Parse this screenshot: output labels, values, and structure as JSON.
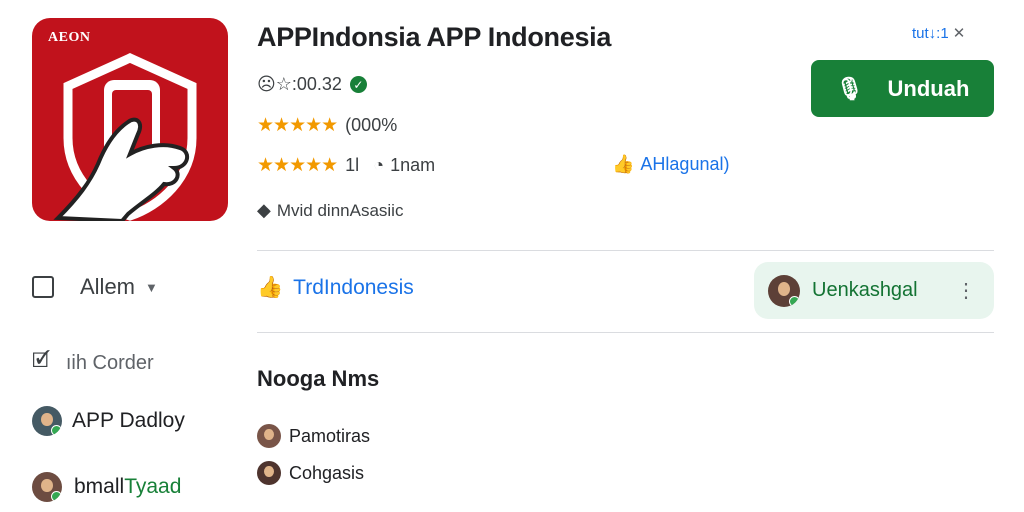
{
  "app": {
    "icon_label": "AEON",
    "title": "APPIndonsia APP Indonesia",
    "rating_line": "☹☆:00.32",
    "stars_1": "★★★★★",
    "rating_count": "(000%",
    "stars_2": "★★★★★",
    "stars_2_value": "1Ɩ",
    "install_icon_text": "◔",
    "installs": "1nam",
    "extra_link": "AHlagunal)",
    "maker": "Mvid dinnAsasiic"
  },
  "window_controls": {
    "label": "tut↓:1",
    "close": "✕"
  },
  "install_button": {
    "label": "Unduah",
    "icon": "mic-icon"
  },
  "sidebar": {
    "all_label": "Allem",
    "order_label": "ıih Corder",
    "user1_name": "APP Dadloy",
    "user2_name_a": "bmall",
    "user2_name_b": "Tyaad"
  },
  "main": {
    "trd_link": "TrdIndonesis",
    "developer_chip": "Uenkashgal",
    "section_title": "Nooga Nms",
    "list": [
      {
        "name": "Pamotiras"
      },
      {
        "name": "Cohgasis"
      }
    ]
  },
  "colors": {
    "icon_background": "#c1121c",
    "install_green": "#188038",
    "link_blue": "#1a73e8",
    "star_orange": "#f29900",
    "chip_background": "#e8f5ee"
  }
}
